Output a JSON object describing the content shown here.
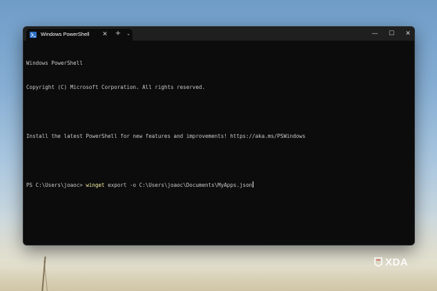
{
  "window": {
    "tab_title": "Windows PowerShell",
    "tab_close_glyph": "✕",
    "new_tab_glyph": "+",
    "dropdown_glyph": "⌄",
    "minimize_glyph": "—",
    "maximize_glyph": "☐",
    "close_glyph": "✕"
  },
  "terminal": {
    "lines": [
      "Windows PowerShell",
      "Copyright (C) Microsoft Corporation. All rights reserved.",
      "",
      "Install the latest PowerShell for new features and improvements! https://aka.ms/PSWindows",
      ""
    ],
    "prompt": "PS C:\\Users\\joaoc> ",
    "command": "winget",
    "arguments": " export -o C:\\Users\\joaoc\\Documents\\MyApps.json"
  },
  "watermark": {
    "text": "XDA"
  },
  "colors": {
    "terminal_bg": "#0c0c0c",
    "titlebar_bg": "#1f1f1f",
    "text": "#cccccc",
    "command": "#f9f1a5",
    "powershell_blue": "#2d6fc6"
  },
  "icons": {
    "tab_icon": "powershell-icon",
    "watermark_logo": "xda-logo-icon"
  }
}
